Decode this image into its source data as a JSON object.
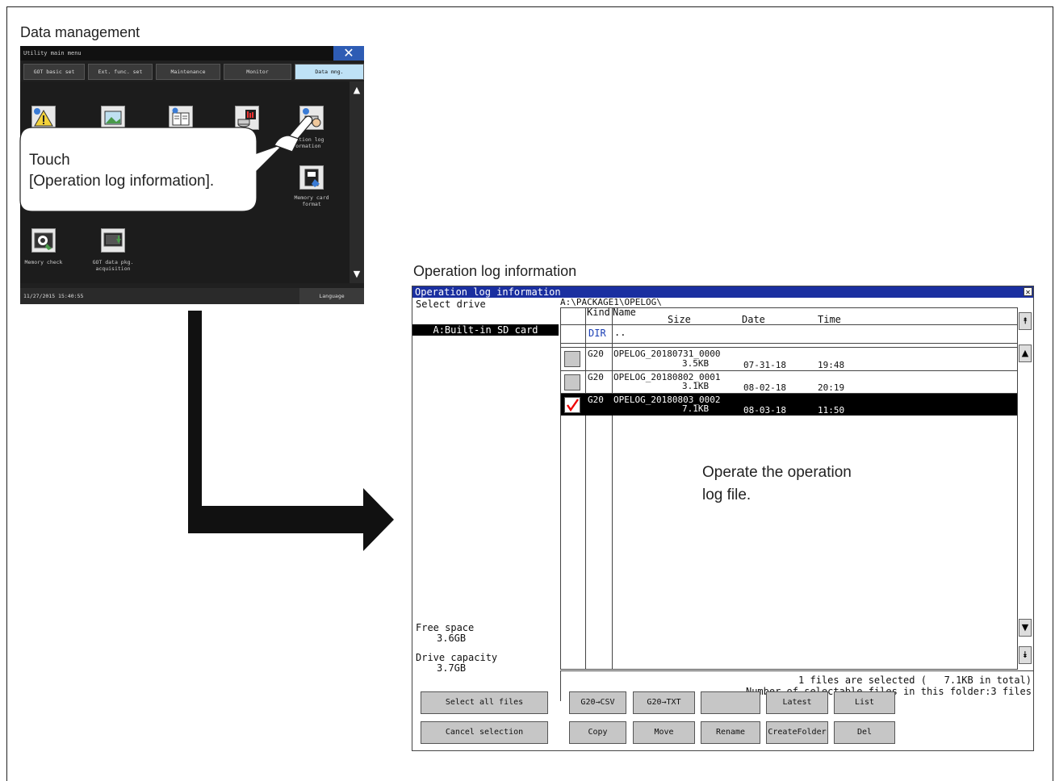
{
  "labels": {
    "data_management": "Data management",
    "operation_log_information": "Operation log information"
  },
  "utility_menu": {
    "title": "Utility main menu",
    "tabs": [
      "GOT basic set",
      "Ext. func. set",
      "Maintenance",
      "Monitor",
      "Data mng."
    ],
    "items": {
      "operation_log": [
        "Operation log",
        "information"
      ],
      "memory_card_format": [
        "Memory card",
        "format"
      ],
      "memory_check": "Memory check",
      "got_data_pkg": [
        "GOT data pkg.",
        "acquisition"
      ]
    },
    "status_time": "11/27/2015 15:40:55",
    "language_button": "Language"
  },
  "callouts": {
    "touch_line1": "Touch",
    "touch_line2": "[Operation log information].",
    "operate_line1": "Operate the operation",
    "operate_line2": "log file."
  },
  "window": {
    "title": "Operation log information",
    "select_drive_label": "Select drive",
    "drive_item": "A:Built-in SD card",
    "path": "A:\\PACKAGE1\\OPELOG\\",
    "headers": {
      "kind": "Kind",
      "name": "Name",
      "size": "Size",
      "date": "Date",
      "time": "Time"
    },
    "dir_row": {
      "kind": "DIR",
      "name": ".."
    },
    "files": [
      {
        "kind": "G20",
        "name": "OPELOG_20180731_0000",
        "size": "3.5KB",
        "date": "07-31-18",
        "time": "19:48",
        "checked": false
      },
      {
        "kind": "G20",
        "name": "OPELOG_20180802_0001",
        "size": "3.1KB",
        "date": "08-02-18",
        "time": "20:19",
        "checked": false
      },
      {
        "kind": "G20",
        "name": "OPELOG_20180803_0002",
        "size": "7.1KB",
        "date": "08-03-18",
        "time": "11:50",
        "checked": true
      }
    ],
    "free_space_label": "Free space",
    "free_space_value": "3.6GB",
    "drive_capacity_label": "Drive capacity",
    "drive_capacity_value": "3.7GB",
    "selected_info": "1 files are selected (   7.1KB in total)",
    "selectable_info": "Number of selectable files in this folder:3 files",
    "buttons_row1": [
      "Select all files",
      "G20→CSV",
      "G20→TXT",
      "",
      "Latest",
      "List"
    ],
    "buttons_row2": [
      "Cancel selection",
      "Copy",
      "Move",
      "Rename",
      "CreateFolder",
      "Del"
    ]
  }
}
